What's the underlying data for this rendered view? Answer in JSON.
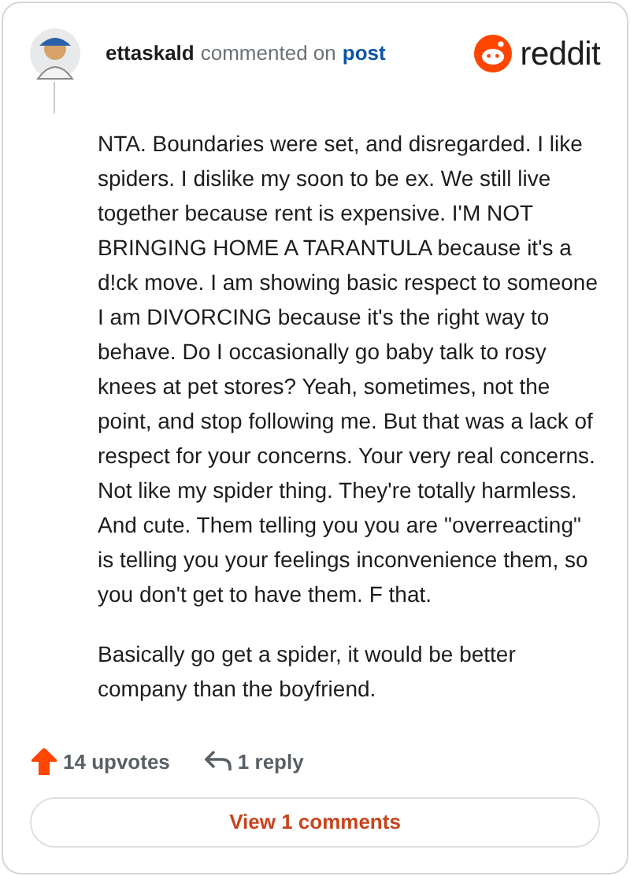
{
  "header": {
    "username": "ettaskald",
    "action": "commented on",
    "link": "post",
    "brand": "reddit"
  },
  "body": {
    "paragraphs": [
      "NTA. Boundaries were set, and disregarded. I like spiders. I dislike my soon to be ex. We still live together because rent is expensive. I'M NOT BRINGING HOME A TARANTULA because it's a d!ck move. I am showing basic respect to someone I am DIVORCING because it's the right way to behave. Do I occasionally go baby talk to rosy knees at pet stores? Yeah, sometimes, not the point, and stop following me. But that was a lack of respect for your concerns. Your very real concerns. Not like my spider thing. They're totally harmless. And cute. Them telling you you are \"overreacting\" is telling you your feelings inconvenience them, so you don't get to have them. F that.",
      "Basically go get a spider, it would be better company than the boyfriend."
    ]
  },
  "footer": {
    "upvotes": "14 upvotes",
    "upvoted": true,
    "replies": "1 reply",
    "view_button": "View 1 comments"
  }
}
